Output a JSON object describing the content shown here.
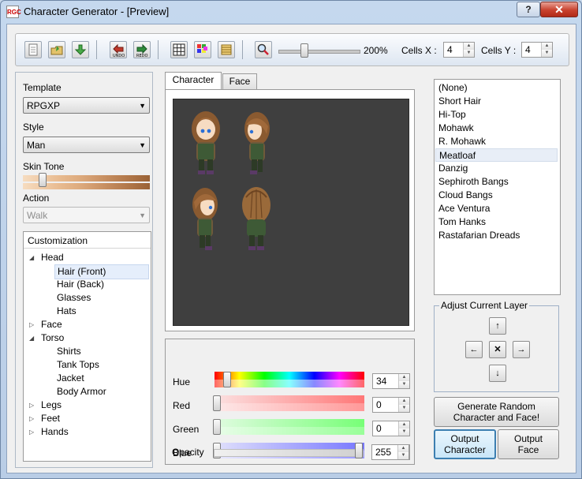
{
  "window": {
    "title": "Character Generator - [Preview]",
    "app_icon_text": "RGC",
    "help_label": "?",
    "close_label": "✕"
  },
  "toolbar": {
    "zoom_level": "200%",
    "zoom_fraction": 0.3,
    "cells_x_label": "Cells X :",
    "cells_x_value": "4",
    "cells_y_label": "Cells Y :",
    "cells_y_value": "4"
  },
  "left": {
    "template_label": "Template",
    "template_value": "RPGXP",
    "style_label": "Style",
    "style_value": "Man",
    "skin_label": "Skin Tone",
    "action_label": "Action",
    "action_value": "Walk",
    "customization_header": "Customization",
    "tree": [
      {
        "label": "Head",
        "level": 0,
        "expand": "◢"
      },
      {
        "label": "Hair (Front)",
        "level": 1,
        "selected": true
      },
      {
        "label": "Hair (Back)",
        "level": 1
      },
      {
        "label": "Glasses",
        "level": 1
      },
      {
        "label": "Hats",
        "level": 1
      },
      {
        "label": "Face",
        "level": 0,
        "expand": "▷"
      },
      {
        "label": "Torso",
        "level": 0,
        "expand": "◢"
      },
      {
        "label": "Shirts",
        "level": 1
      },
      {
        "label": "Tank Tops",
        "level": 1
      },
      {
        "label": "Jacket",
        "level": 1
      },
      {
        "label": "Body Armor",
        "level": 1
      },
      {
        "label": "Legs",
        "level": 0,
        "expand": "▷"
      },
      {
        "label": "Feet",
        "level": 0,
        "expand": "▷"
      },
      {
        "label": "Hands",
        "level": 0,
        "expand": "▷"
      }
    ]
  },
  "tabs": {
    "character": "Character",
    "face": "Face"
  },
  "color": {
    "hue_label": "Hue",
    "hue_value": "34",
    "red_label": "Red",
    "red_value": "0",
    "green_label": "Green",
    "green_value": "0",
    "blue_label": "Blue",
    "blue_value": "0",
    "opacity_label": "Opacity",
    "opacity_value": "255"
  },
  "layers": [
    "(None)",
    "Short Hair",
    "Hi-Top",
    "Mohawk",
    "R. Mohawk",
    "Meatloaf",
    "Danzig",
    "Sephiroth Bangs",
    "Cloud Bangs",
    "Ace Ventura",
    "Tom Hanks",
    "Rastafarian Dreads"
  ],
  "selected_layer": "Meatloaf",
  "adjust": {
    "title": "Adjust Current Layer",
    "up": "↑",
    "down": "↓",
    "left": "←",
    "right": "→",
    "center": "✕"
  },
  "buttons": {
    "random": "Generate Random Character and Face!",
    "output_character": "Output Character",
    "output_face": "Output Face"
  }
}
